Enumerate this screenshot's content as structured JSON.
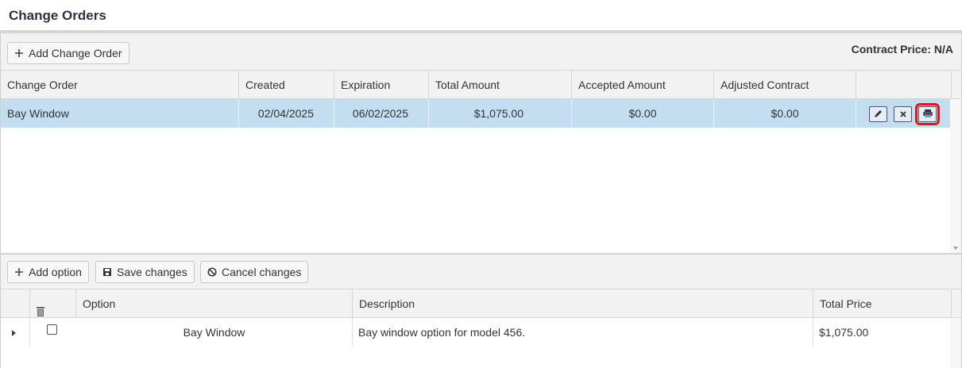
{
  "page": {
    "title": "Change Orders"
  },
  "toolbar": {
    "add_change_order_label": "Add Change Order",
    "contract_price_text": "Contract Price: N/A"
  },
  "change_orders_grid": {
    "columns": [
      "Change Order",
      "Created",
      "Expiration",
      "Total Amount",
      "Accepted Amount",
      "Adjusted Contract"
    ],
    "rows": [
      {
        "name": "Bay Window",
        "created": "02/04/2025",
        "expiration": "06/02/2025",
        "total_amount": "$1,075.00",
        "accepted_amount": "$0.00",
        "adjusted_contract": "$0.00",
        "actions": [
          "pencil-icon",
          "close-icon",
          "print-icon"
        ]
      }
    ],
    "selected_row_color": "#c3def0",
    "highlight_color": "#e01515"
  },
  "options_toolbar": {
    "add_option_label": "Add option",
    "save_changes_label": "Save changes",
    "cancel_changes_label": "Cancel changes"
  },
  "options_grid": {
    "columns": [
      "Option",
      "Description",
      "Total Price"
    ],
    "delete_column_icon": "trash-icon",
    "rows": [
      {
        "option": "Bay Window",
        "description": "Bay window option for model 456.",
        "total_price": "$1,075.00",
        "checked": false
      }
    ]
  }
}
